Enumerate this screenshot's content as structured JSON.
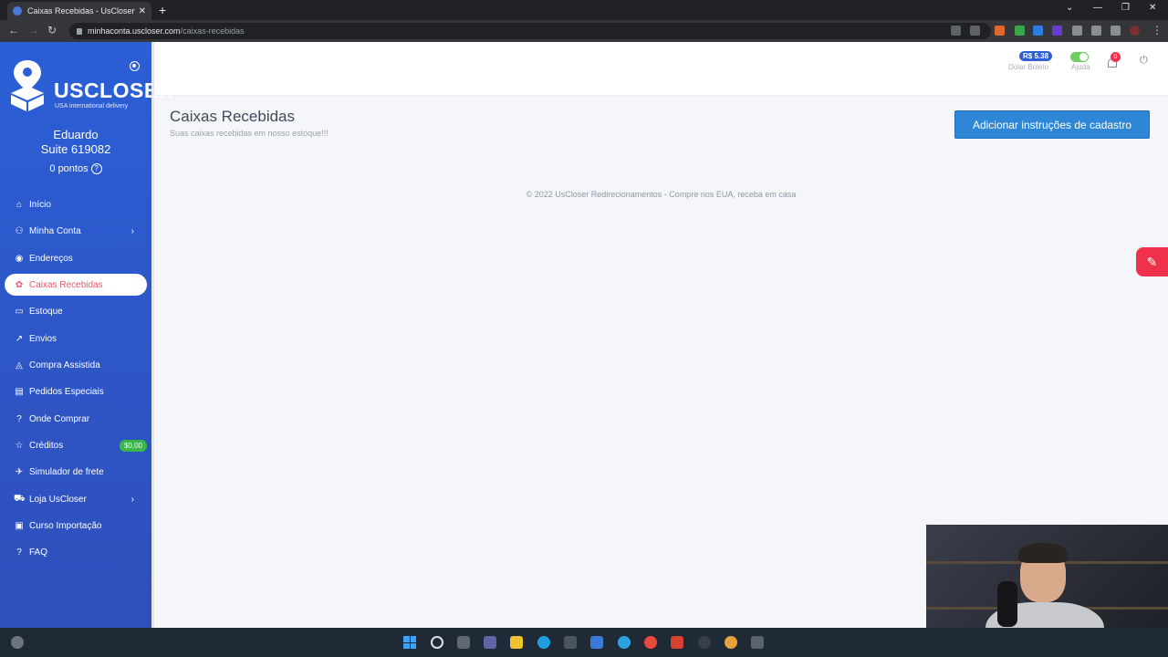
{
  "browser": {
    "tab_title": "Caixas Recebidas - UsCloser Redi",
    "url_host": "minhaconta.uscloser.com",
    "url_path": "/caixas-recebidas"
  },
  "brand": {
    "name": "USCLOSER",
    "tagline": "USA international delivery"
  },
  "user": {
    "name": "Eduardo",
    "suite": "Suite 619082",
    "points": "0 pontos"
  },
  "menu": [
    {
      "label": "Início",
      "icon": "home-icon",
      "glyph": "⌂"
    },
    {
      "label": "Minha Conta",
      "icon": "user-icon",
      "glyph": "⚇",
      "has_children": true
    },
    {
      "label": "Endereços",
      "icon": "map-pin-icon",
      "glyph": "◉"
    },
    {
      "label": "Caixas Recebidas",
      "icon": "gift-icon",
      "glyph": "✿",
      "active": true
    },
    {
      "label": "Estoque",
      "icon": "inbox-icon",
      "glyph": "▭"
    },
    {
      "label": "Envios",
      "icon": "share-icon",
      "glyph": "↗"
    },
    {
      "label": "Compra Assistida",
      "icon": "bag-icon",
      "glyph": "◬"
    },
    {
      "label": "Pedidos Especiais",
      "icon": "cart-icon",
      "glyph": "▤"
    },
    {
      "label": "Onde Comprar",
      "icon": "help-circle-icon",
      "glyph": "?"
    },
    {
      "label": "Créditos",
      "icon": "star-icon",
      "glyph": "☆",
      "badge": "$0,00"
    },
    {
      "label": "Simulador de frete",
      "icon": "plane-icon",
      "glyph": "✈"
    },
    {
      "label": "Loja UsCloser",
      "icon": "shopping-cart-icon",
      "glyph": "⛟",
      "has_children": true
    },
    {
      "label": "Curso Importação",
      "icon": "monitor-icon",
      "glyph": "▣"
    },
    {
      "label": "FAQ",
      "icon": "question-icon",
      "glyph": "?"
    }
  ],
  "header": {
    "rate_value": "R$ 5.38",
    "rate_label": "Dolar Boleto",
    "help_label": "Ajuda",
    "notification_count": "0"
  },
  "main": {
    "title": "Caixas Recebidas",
    "subtitle": "Suas caixas recebidas em nosso estoque!!!",
    "add_button": "Adicionar instruções de cadastro"
  },
  "footer": {
    "text": "© 2022 UsCloser Redirecionamentos - Compre nos EUA, receba em casa"
  },
  "colors": {
    "sidebar": "#2b5fd6",
    "accent": "#f0566b",
    "button": "#2e87d6",
    "credit_badge": "#39b54a"
  }
}
